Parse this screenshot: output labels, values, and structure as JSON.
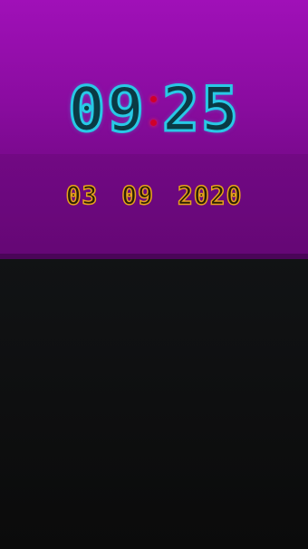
{
  "clock": {
    "hours": "09",
    "minutes": "25",
    "digit_color": "#28c9e6",
    "separator_color": "#d0002a"
  },
  "date": {
    "day": "03",
    "month": "09",
    "year": "2020",
    "color": "#e8a21c"
  },
  "widget": {
    "background": "#8a0ca0"
  }
}
